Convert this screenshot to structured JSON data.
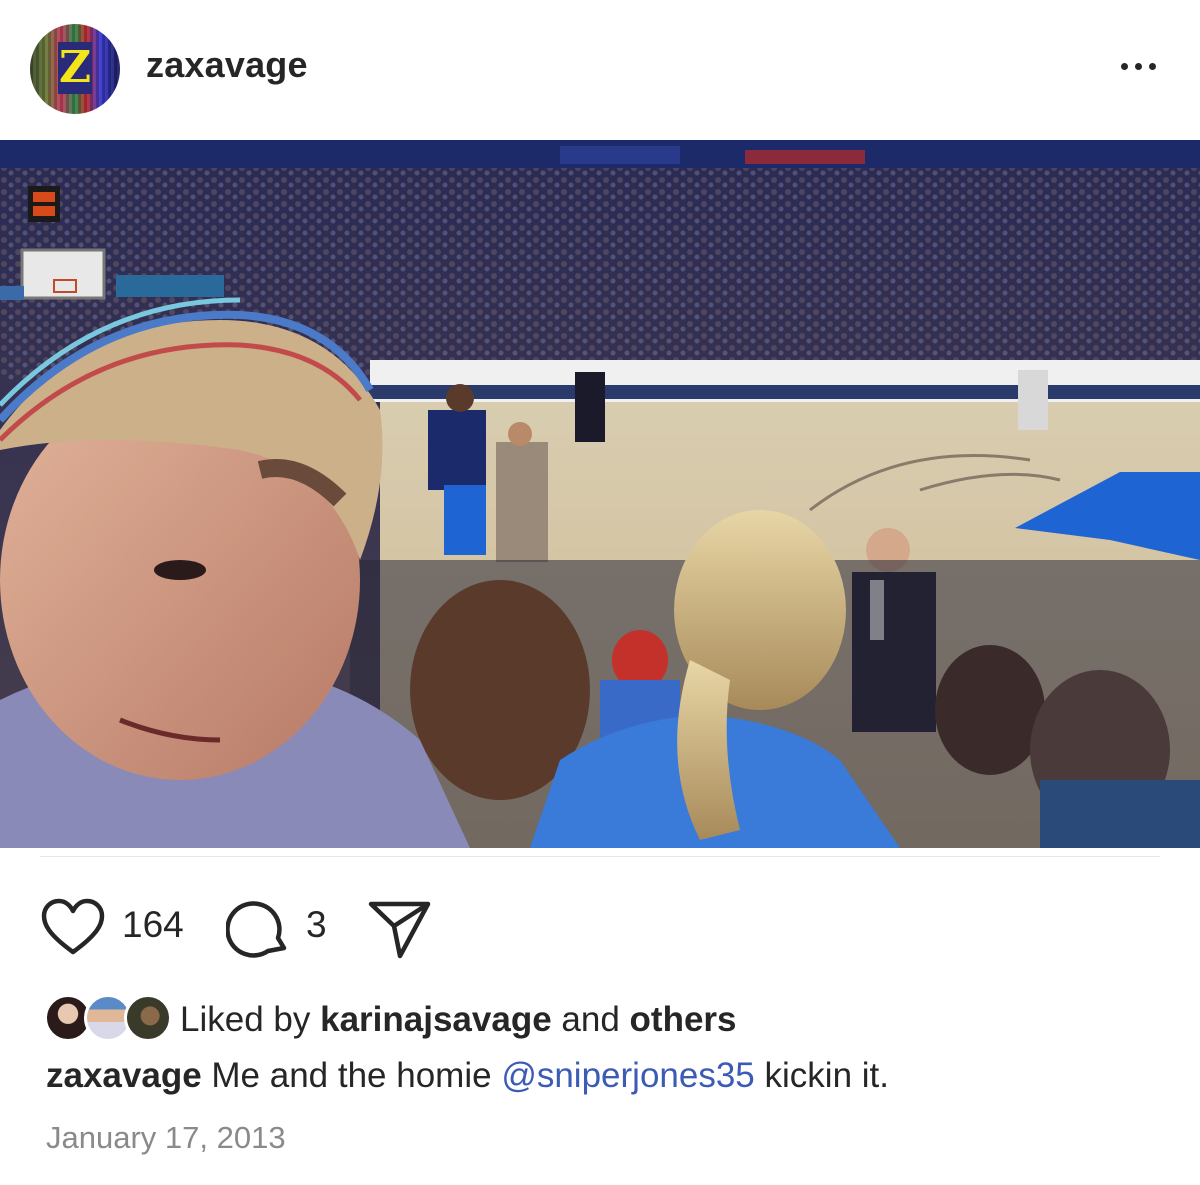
{
  "post": {
    "username": "zaxavage",
    "avatar_letter": "Z",
    "image_alt": "Selfie at a basketball game with players warming up on the court",
    "like_count": "164",
    "comment_count": "3",
    "liked_by": {
      "prefix": "Liked by",
      "user": "karinajsavage",
      "joiner": "and",
      "others": "others"
    },
    "caption": {
      "username": "zaxavage",
      "text_before": "Me and the homie",
      "mention": "@sniperjones35",
      "text_after": "kickin it."
    },
    "date": "January 17, 2013"
  },
  "icons": {
    "more": "more-horizontal-icon",
    "like": "heart-icon",
    "comment": "comment-bubble-icon",
    "share": "paper-plane-icon"
  },
  "colors": {
    "text": "#262626",
    "mention": "#3b5bb5",
    "date": "#8a8a8a",
    "court_blue": "#1e64d2"
  }
}
